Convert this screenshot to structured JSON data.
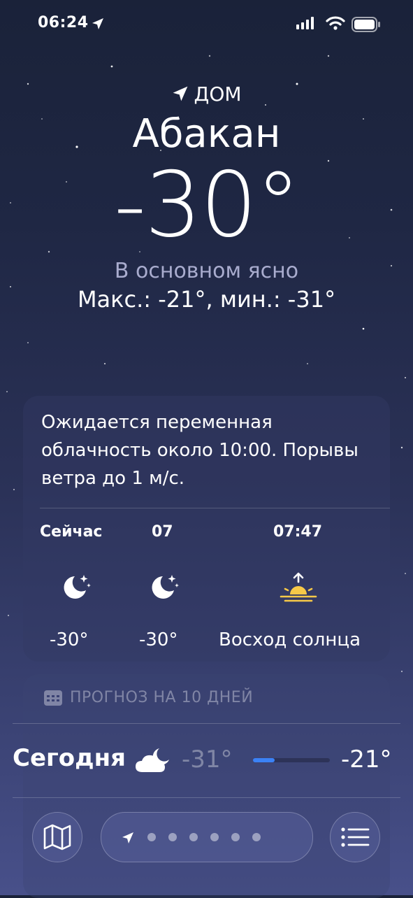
{
  "status_bar": {
    "time": "06:24"
  },
  "header": {
    "home_label": "ДОМ",
    "city": "Абакан",
    "temperature": "-30°",
    "condition": "В основном ясно",
    "range": "Макс.: -21°, мин.: -31°"
  },
  "hourly_card": {
    "summary": "Ожидается переменная облачность около 10:00. Порывы ветра до 1 м/с.",
    "items": [
      {
        "label": "Сейчас",
        "icon": "moon-stars-icon",
        "temp": "-30°"
      },
      {
        "label": "07",
        "icon": "moon-stars-icon",
        "temp": "-30°"
      },
      {
        "label": "07:47",
        "icon": "sunrise-icon",
        "temp": "Восход солнца"
      }
    ]
  },
  "daily_card": {
    "title": "ПРОГНОЗ НА 10 ДНЕЙ",
    "rows": [
      {
        "day": "Сегодня",
        "icon": "partly-cloudy-night-icon",
        "low": "-31°",
        "high": "-21°",
        "bar_start": 0.0,
        "bar_end": 0.28
      }
    ]
  },
  "colors": {
    "accent_blue": "#3b82f6",
    "condition_text": "#a9acce",
    "sun_yellow": "#f7c948"
  },
  "tabbar": {
    "page_dots": 6
  }
}
